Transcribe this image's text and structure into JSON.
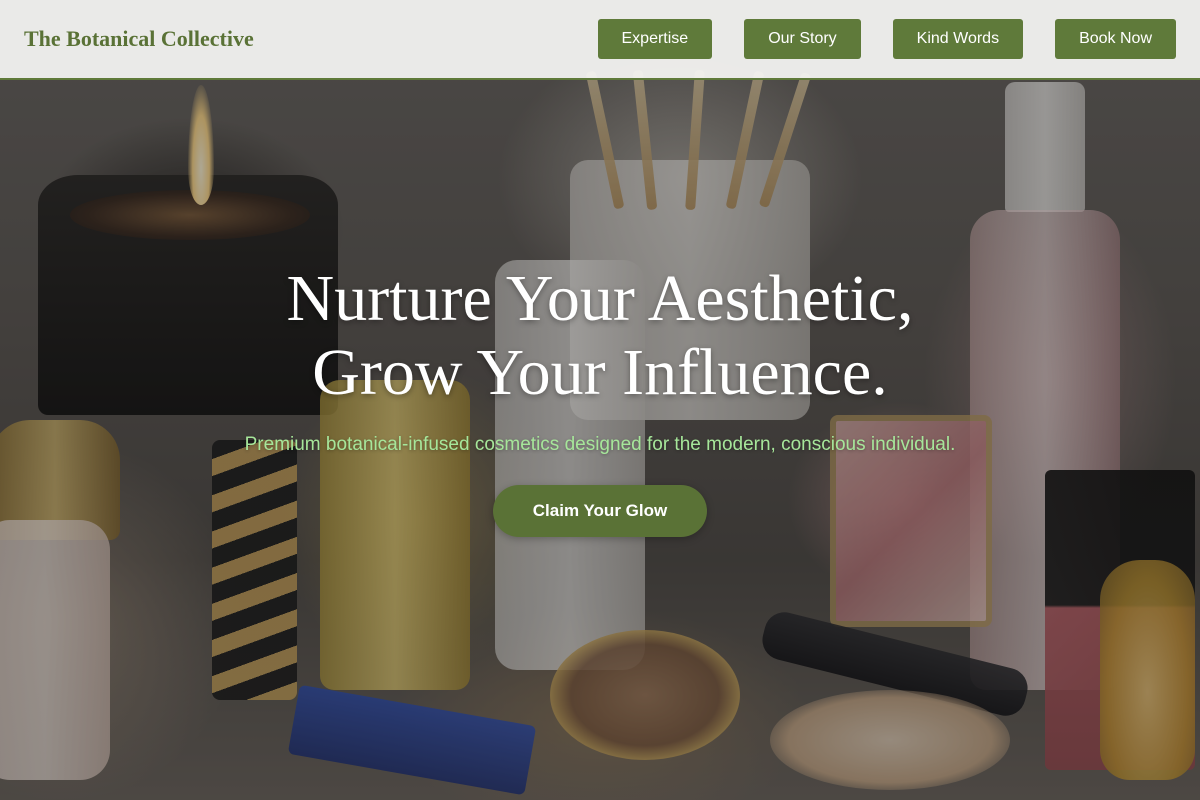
{
  "header": {
    "brand": "The Botanical Collective",
    "nav": [
      {
        "label": "Expertise"
      },
      {
        "label": "Our Story"
      },
      {
        "label": "Kind Words"
      },
      {
        "label": "Book Now"
      }
    ]
  },
  "hero": {
    "title_line1": "Nurture Your Aesthetic,",
    "title_line2": "Grow Your Influence.",
    "subtitle": "Premium botanical-infused cosmetics designed for the modern, conscious individual.",
    "cta_label": "Claim Your Glow"
  },
  "colors": {
    "brand_green": "#5f7a3a",
    "subtitle_green": "#a6e69a",
    "header_bg": "#f4f4f2"
  }
}
